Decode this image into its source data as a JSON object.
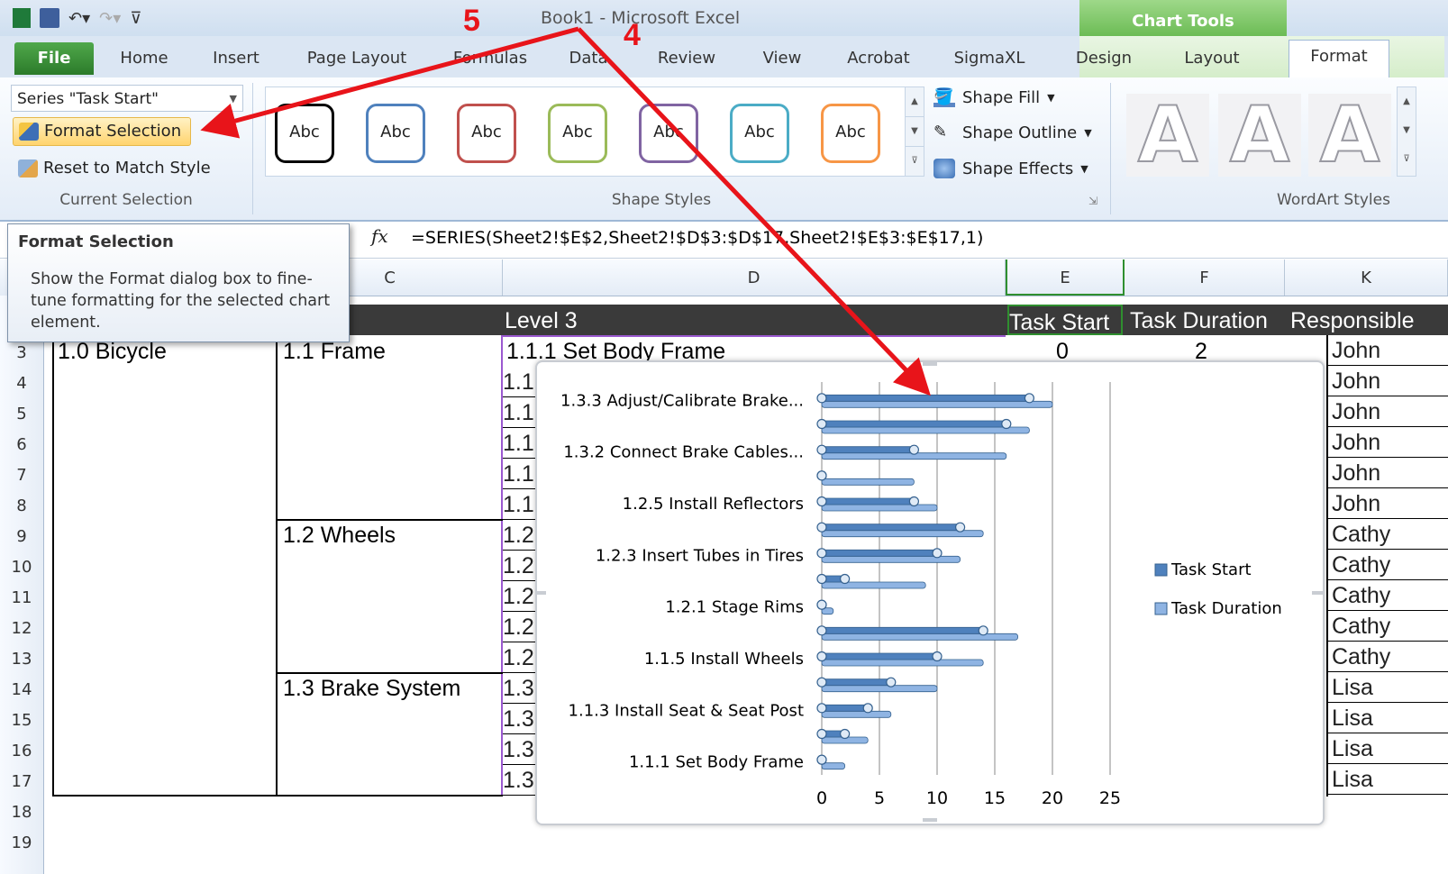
{
  "app": {
    "title": "Book1  -  Microsoft Excel",
    "context_tab_group": "Chart Tools"
  },
  "tabs": [
    "File",
    "Home",
    "Insert",
    "Page Layout",
    "Formulas",
    "Data",
    "Review",
    "View",
    "Acrobat",
    "SigmaXL",
    "Design",
    "Layout",
    "Format"
  ],
  "ribbon": {
    "current_selection": {
      "series_value": "Series \"Task Start\"",
      "format_selection": "Format Selection",
      "reset_to_match_style": "Reset to Match Style",
      "group_label": "Current Selection"
    },
    "shape_styles": {
      "samples": [
        "Abc",
        "Abc",
        "Abc",
        "Abc",
        "Abc",
        "Abc",
        "Abc"
      ],
      "sample_colors": [
        "#000000",
        "#4f81bd",
        "#c0504d",
        "#9bbb59",
        "#8064a2",
        "#4bacc6",
        "#f79646"
      ],
      "shape_fill": "Shape Fill",
      "shape_outline": "Shape Outline",
      "shape_effects": "Shape Effects",
      "group_label": "Shape Styles"
    },
    "wordart": {
      "letters": [
        "A",
        "A",
        "A"
      ],
      "group_label": "WordArt Styles"
    }
  },
  "tooltip": {
    "title": "Format Selection",
    "body": "Show the Format dialog box to fine-tune formatting for the selected chart element."
  },
  "formula_bar": {
    "fx": "fx",
    "formula": "=SERIES(Sheet2!$E$2,Sheet2!$D$3:$D$17,Sheet2!$E$3:$E$17,1)"
  },
  "grid": {
    "columns": [
      "C",
      "D",
      "E",
      "F",
      "K"
    ],
    "row_numbers": [
      "3",
      "4",
      "5",
      "6",
      "7",
      "8",
      "9",
      "10",
      "11",
      "12",
      "13",
      "14",
      "15",
      "16",
      "17",
      "18",
      "19"
    ],
    "header_row": {
      "level2_partial": "2",
      "level3": "Level 3",
      "task_start": "Task Start",
      "task_duration": "Task Duration",
      "responsible": "Responsible"
    },
    "level1": "1.0 Bicycle",
    "level2": [
      "1.1 Frame",
      "1.2 Wheels",
      "1.3 Brake System"
    ],
    "row3_task": "1.1.1 Set Body Frame",
    "row3_start": "0",
    "row3_duration": "2",
    "d_partials": [
      "1.1",
      "1.1",
      "1.1",
      "1.1",
      "1.1",
      "1.2",
      "1.2",
      "1.2",
      "1.2",
      "1.2",
      "1.3",
      "1.3",
      "1.3",
      "1.3"
    ],
    "responsible": [
      "John",
      "John",
      "John",
      "John",
      "John",
      "John",
      "Cathy",
      "Cathy",
      "Cathy",
      "Cathy",
      "Cathy",
      "Lisa",
      "Lisa",
      "Lisa",
      "Lisa"
    ]
  },
  "annotations": {
    "step5": "5",
    "step4": "4"
  },
  "chart_data": {
    "type": "bar",
    "orientation": "horizontal",
    "stacked": false,
    "categories": [
      "1.1.1 Set Body Frame",
      "",
      "1.1.3 Install Seat & Seat Post",
      "",
      "1.1.5 Install Wheels",
      "",
      "1.2.1 Stage Rims",
      "",
      "1.2.3 Insert Tubes in Tires",
      "",
      "1.2.5 Install Reflectors",
      "",
      "1.3.2 Connect Brake Cables...",
      "",
      "1.3.3 Adjust/Calibrate Brake..."
    ],
    "series": [
      {
        "name": "Task Start",
        "values": [
          0,
          2,
          4,
          6,
          10,
          14,
          0,
          2,
          10,
          12,
          8,
          0,
          8,
          16,
          18
        ],
        "color": "#4f81bd"
      },
      {
        "name": "Task Duration",
        "values": [
          2,
          4,
          6,
          10,
          14,
          17,
          1,
          9,
          12,
          14,
          10,
          8,
          16,
          18,
          20
        ],
        "color": "#8fb4e3"
      }
    ],
    "xlim": [
      0,
      25
    ],
    "xticks": [
      "0",
      "5",
      "10",
      "15",
      "20",
      "25"
    ],
    "grid": true,
    "legend": "right"
  }
}
